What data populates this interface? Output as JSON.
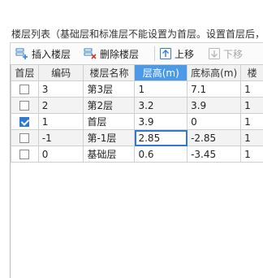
{
  "panel": {
    "title": "楼层列表（基础层和标准层不能设置为首层。设置首层后，"
  },
  "toolbar": {
    "insert_label": "插入楼层",
    "delete_label": "删除楼层",
    "up_label": "上移",
    "down_label": "下移"
  },
  "columns": [
    "首层",
    "编码",
    "楼层名称",
    "层高(m)",
    "底标高(m)",
    "楼"
  ],
  "rows": [
    {
      "first": false,
      "code": "3",
      "name": "第3层",
      "height": "1",
      "base": "7.1",
      "extra": "1"
    },
    {
      "first": false,
      "code": "2",
      "name": "第2层",
      "height": "3.2",
      "base": "3.9",
      "extra": "1"
    },
    {
      "first": true,
      "code": "1",
      "name": "首层",
      "height": "3.9",
      "base": "0",
      "extra": "1"
    },
    {
      "first": false,
      "code": "-1",
      "name": "第-1层",
      "height": "2.85",
      "base": "-2.85",
      "extra": "1"
    },
    {
      "first": false,
      "code": "0",
      "name": "基础层",
      "height": "0.6",
      "base": "-3.45",
      "extra": "1"
    }
  ],
  "colors": {
    "accent": "#2e7ad1",
    "header_active": "#4a9ae8"
  }
}
